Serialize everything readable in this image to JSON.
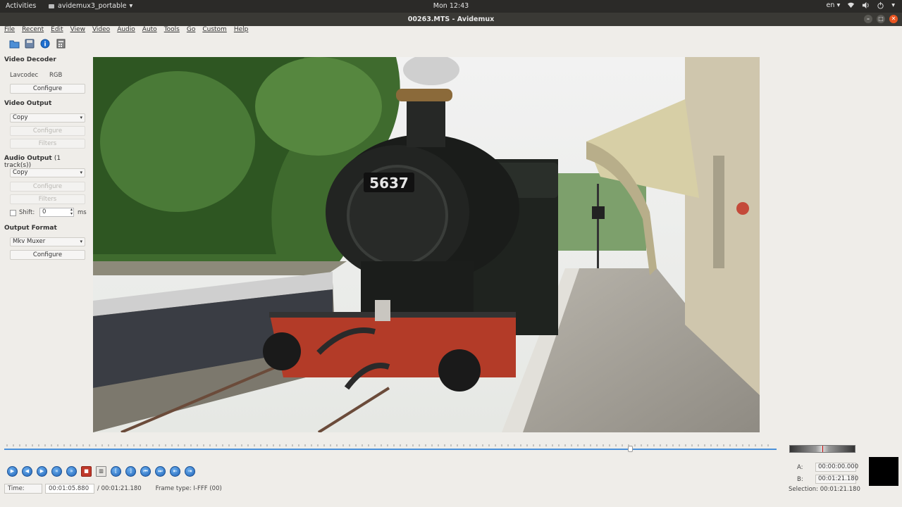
{
  "topbar": {
    "activities": "Activities",
    "app_name": "avidemux3_portable",
    "clock": "Mon 12:43",
    "input_method": "en"
  },
  "window": {
    "title": "00263.MTS - Avidemux"
  },
  "menu": [
    "File",
    "Recent",
    "Edit",
    "View",
    "Video",
    "Audio",
    "Auto",
    "Tools",
    "Go",
    "Custom",
    "Help"
  ],
  "left_panel": {
    "video_decoder": {
      "title": "Video Decoder",
      "decoder_name": "Lavcodec",
      "decoder_format": "RGB",
      "configure_label": "Configure"
    },
    "video_output": {
      "title": "Video Output",
      "codec": "Copy",
      "configure_label": "Configure",
      "filters_label": "Filters"
    },
    "audio_output": {
      "title": "Audio Output",
      "tracks": "(1 track(s))",
      "codec": "Copy",
      "configure_label": "Configure",
      "filters_label": "Filters",
      "shift_label": "Shift:",
      "shift_value": "0",
      "shift_unit": "ms"
    },
    "output_format": {
      "title": "Output Format",
      "muxer": "Mkv Muxer",
      "configure_label": "Configure"
    }
  },
  "video": {
    "locomotive_number": "5637"
  },
  "timeline": {
    "position_fraction": 0.81
  },
  "status": {
    "time_label": "Time:",
    "current_time": "00:01:05.880",
    "total_time": "/ 00:01:21.180",
    "frame_type": "Frame type:  I-FFF (00)"
  },
  "selection": {
    "a_label": "A:",
    "a_value": "00:00:00.000",
    "b_label": "B:",
    "b_value": "00:01:21.180",
    "selection_label": "Selection:",
    "selection_value": "00:01:21.180"
  },
  "colors": {
    "accent": "#4a90d9",
    "close_button": "#e95420",
    "record_button": "#c0392b"
  }
}
